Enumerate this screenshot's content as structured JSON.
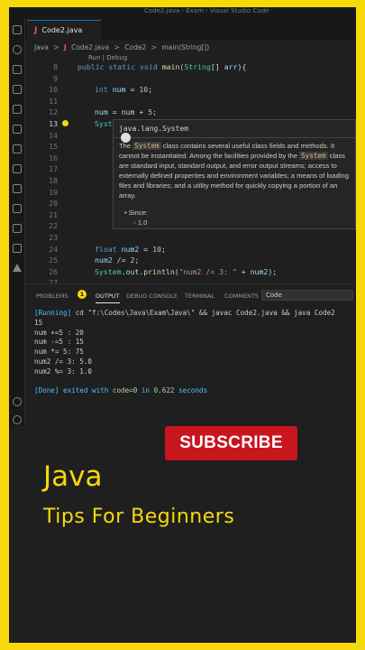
{
  "titlebar": {
    "text": "Code2.java - Exam - Visual Studio Code"
  },
  "tab": {
    "icon": "J",
    "label": "Code2.java"
  },
  "breadcrumb": [
    "Java",
    ">",
    "J",
    "Code2.java",
    ">",
    "Code2",
    ">",
    "main(String[])"
  ],
  "codelens": "Run | Debug",
  "code": [
    {
      "ln": "8",
      "text": "public static void main(String[] arr){"
    },
    {
      "ln": "9",
      "text": ""
    },
    {
      "ln": "10",
      "text": "int num = 10;"
    },
    {
      "ln": "11",
      "text": ""
    },
    {
      "ln": "12",
      "text": "num = num + 5;"
    },
    {
      "ln": "13",
      "text": "System.out.println(num);"
    },
    {
      "ln": "14",
      "text": ""
    },
    {
      "ln": "15",
      "text": ""
    },
    {
      "ln": "16",
      "text": ""
    },
    {
      "ln": "17",
      "text": ""
    },
    {
      "ln": "18",
      "text": ""
    },
    {
      "ln": "19",
      "text": ""
    },
    {
      "ln": "20",
      "text": ""
    },
    {
      "ln": "21",
      "text": ""
    },
    {
      "ln": "22",
      "text": ""
    },
    {
      "ln": "23",
      "text": ""
    },
    {
      "ln": "24",
      "text": "float num2 = 10;"
    },
    {
      "ln": "25",
      "text": "num2 /= 2;"
    },
    {
      "ln": "26",
      "text": "System.out.println(\"num2 /= 3: \" + num2);"
    },
    {
      "ln": "27",
      "text": ""
    },
    {
      "ln": "28",
      "text": "num2 %= 2;"
    },
    {
      "ln": "29",
      "text": "System.out.println(\"num2 %= 3: \" + num2);"
    }
  ],
  "hover": {
    "title": "java.lang.System",
    "body_pre": "The ",
    "body_code1": "System",
    "body_mid": " class contains several useful class fields and methods. It cannot be instantiated. Among the facilities provided by the ",
    "body_code2": "System",
    "body_post": " class are standard input, standard output, and error output streams; access to externally defined properties and environment variables; a means of loading files and libraries; and a utility method for quickly copying a portion of an array.",
    "since_label": "Since:",
    "since_value": "1.0"
  },
  "panel": {
    "tabs": [
      "PROBLEMS",
      "OUTPUT",
      "DEBUG CONSOLE",
      "TERMINAL",
      "COMMENTS"
    ],
    "problems_count": "1",
    "select_value": "Code",
    "output_lines": [
      "[Running] cd \"f:\\Codes\\Java\\Exam\\Java\\\" && javac Code2.java && java Code2",
      "15",
      "num +=5 : 20",
      "num -=5 : 15",
      "num *= 5: 75",
      "num2 /= 3: 5.0",
      "num2 %= 3: 1.0",
      "",
      "[Done] exited with code=0 in 0.622 seconds"
    ]
  },
  "overlay": {
    "subscribe": "SUBSCRIBE",
    "title": "Java",
    "subtitle": "Tips For Beginners"
  },
  "colors": {
    "accent": "#f5d90b",
    "subscribe_red": "#c8151e",
    "editor_bg": "#1f1f1f"
  }
}
